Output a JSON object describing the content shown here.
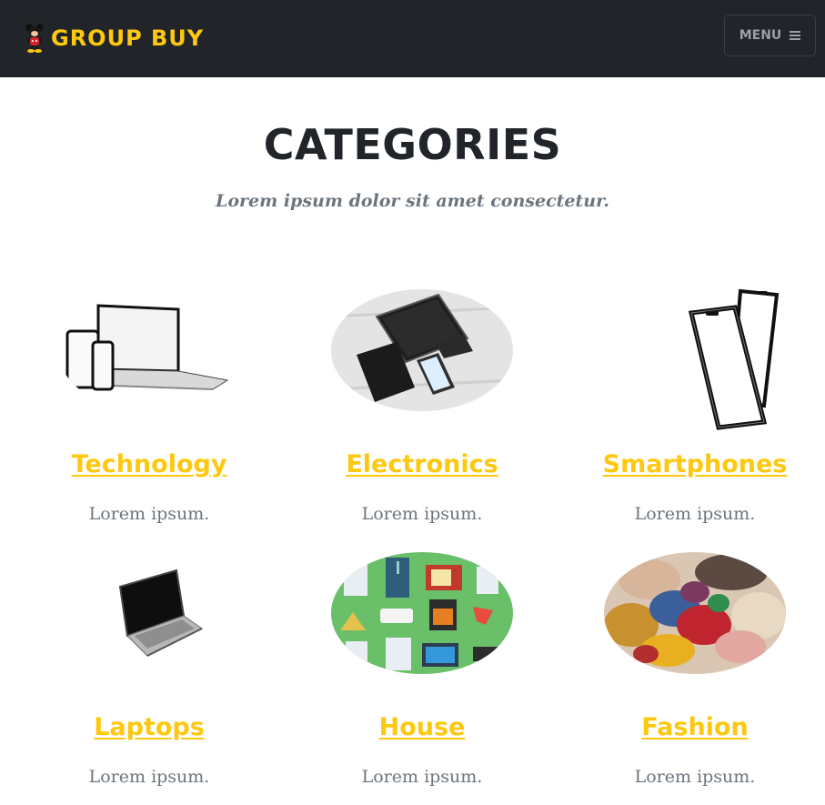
{
  "navbar": {
    "brand": "GROUP BUY",
    "menu_label": "MENU",
    "icons": {
      "logo": "mouse-mascot-icon",
      "menu": "hamburger-icon"
    },
    "colors": {
      "background": "#212529",
      "brand": "#fec810",
      "menu_text": "#9aa0a6"
    }
  },
  "header": {
    "title": "CATEGORIES",
    "subtitle": "Lorem ipsum dolor sit amet consectetur."
  },
  "categories": [
    {
      "name": "Technology",
      "description": "Lorem ipsum.",
      "image": "devices-image"
    },
    {
      "name": "Electronics",
      "description": "Lorem ipsum.",
      "image": "tablets-image"
    },
    {
      "name": "Smartphones",
      "description": "Lorem ipsum.",
      "image": "smartphones-image"
    },
    {
      "name": "Laptops",
      "description": "Lorem ipsum.",
      "image": "laptop-image"
    },
    {
      "name": "House",
      "description": "Lorem ipsum.",
      "image": "appliances-image"
    },
    {
      "name": "Fashion",
      "description": "Lorem ipsum.",
      "image": "clothes-image"
    }
  ],
  "colors": {
    "accent": "#fec810",
    "heading": "#212529",
    "muted": "#6c757d"
  }
}
